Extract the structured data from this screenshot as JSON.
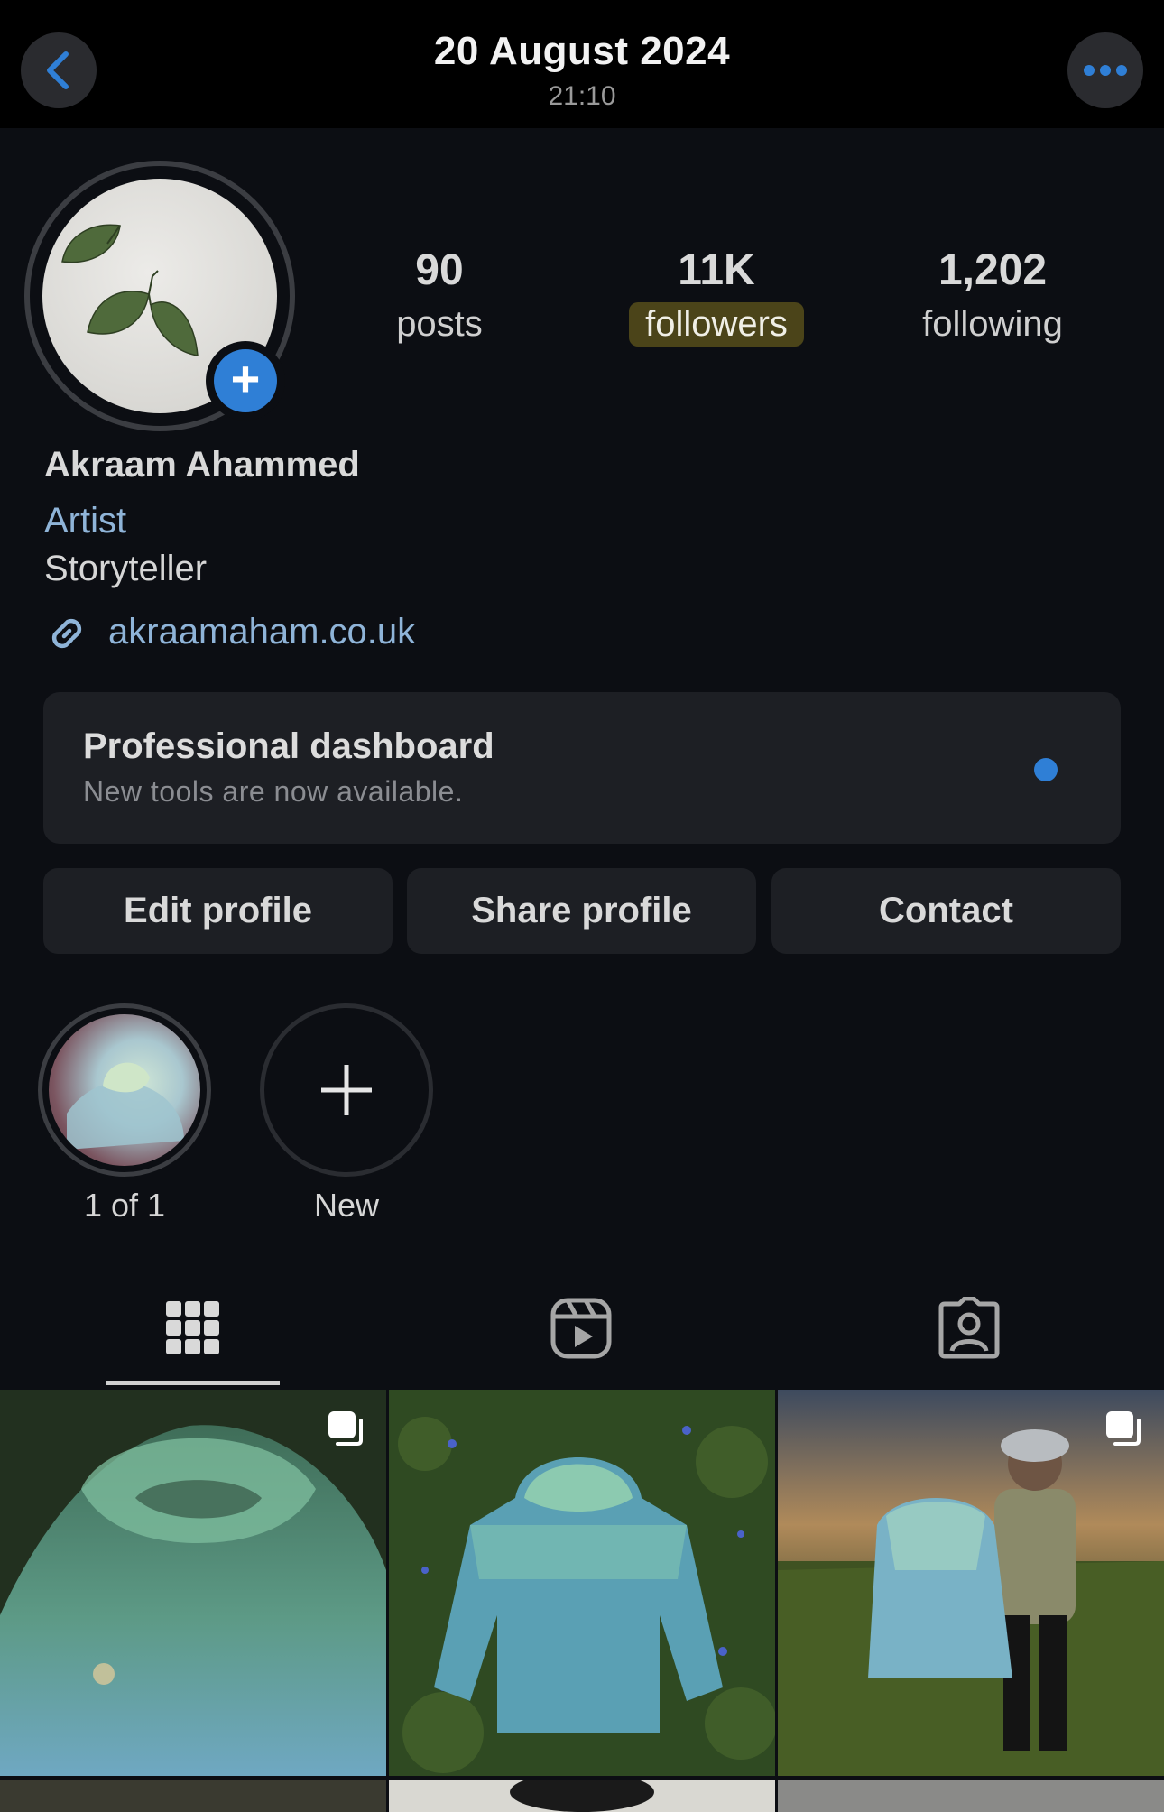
{
  "header": {
    "title": "20 August 2024",
    "subtitle": "21:10",
    "back_icon": "chevron-left-icon",
    "more_icon": "more-horizontal-icon",
    "accent": "#2f7fd6"
  },
  "profile": {
    "stats": [
      {
        "value": "90",
        "label": "posts"
      },
      {
        "value": "11K",
        "label": "followers"
      },
      {
        "value": "1,202",
        "label": "following"
      }
    ],
    "name": "Akraam Ahammed",
    "category": "Artist",
    "bio": "Storyteller",
    "link": "akraamaham.co.uk"
  },
  "dashboard": {
    "title": "Professional dashboard",
    "subtitle": "New tools are now available."
  },
  "buttons": {
    "edit": "Edit profile",
    "share": "Share profile",
    "contact": "Contact"
  },
  "highlights": [
    {
      "label": "1 of 1"
    },
    {
      "label": "New"
    }
  ],
  "tabs": [
    {
      "icon": "grid-icon",
      "active": true
    },
    {
      "icon": "reels-icon",
      "active": false
    },
    {
      "icon": "tagged-icon",
      "active": false
    }
  ]
}
